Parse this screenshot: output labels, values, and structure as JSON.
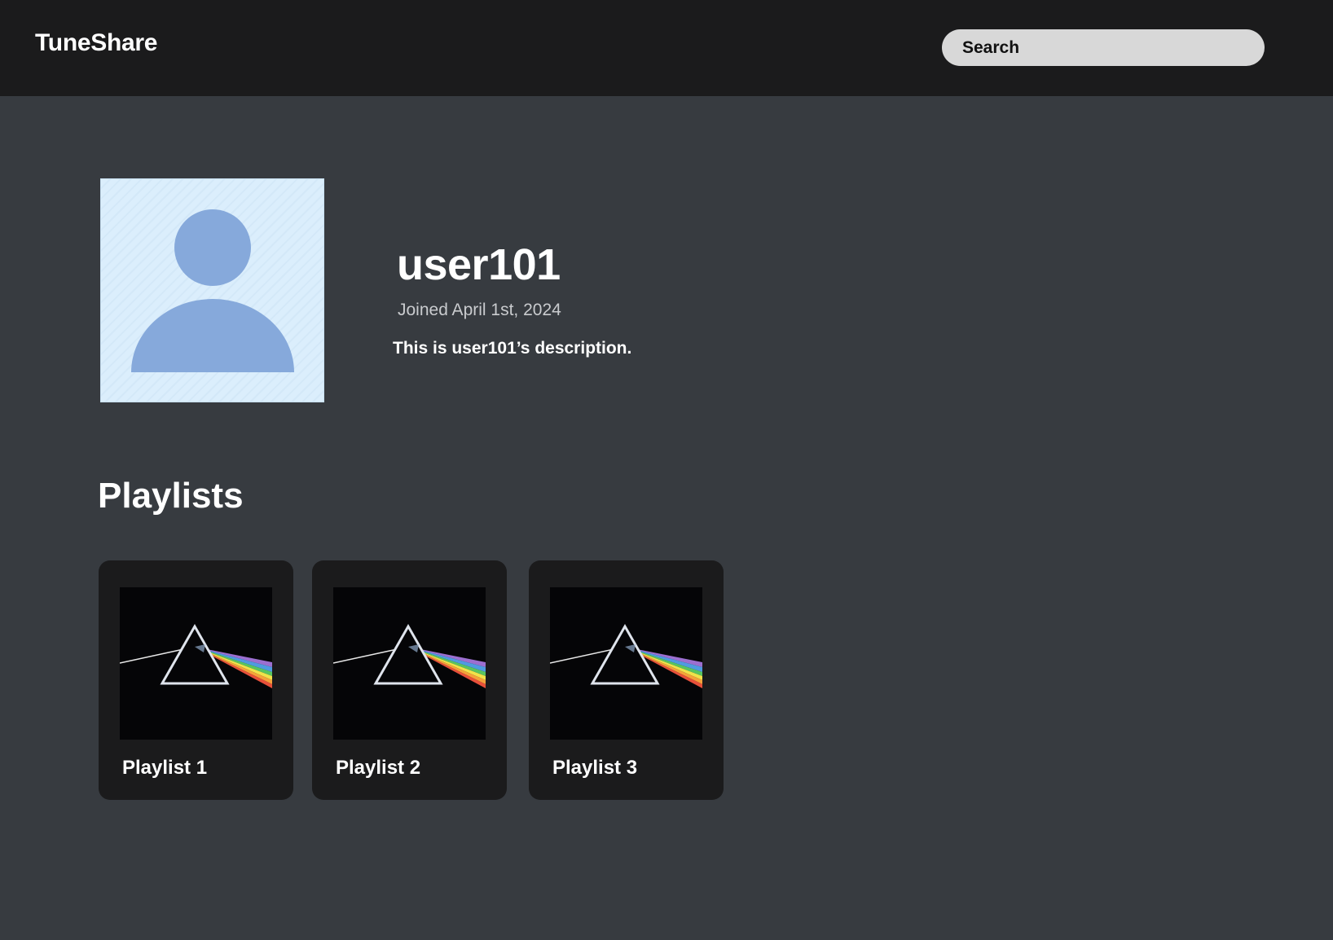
{
  "app": {
    "name": "TuneShare"
  },
  "header": {
    "search_placeholder": "Search"
  },
  "profile": {
    "username": "user101",
    "joined": "Joined April 1st, 2024",
    "description": "This is user101’s description.",
    "avatar_icon": "user-silhouette-icon"
  },
  "playlists": {
    "title": "Playlists",
    "items": [
      {
        "label": "Playlist 1",
        "cover_icon": "prism-album-cover"
      },
      {
        "label": "Playlist 2",
        "cover_icon": "prism-album-cover"
      },
      {
        "label": "Playlist 3",
        "cover_icon": "prism-album-cover"
      }
    ]
  },
  "colors": {
    "topbar_bg": "#1b1b1c",
    "page_bg": "#373b40",
    "card_bg": "#1b1b1c",
    "search_bg": "#d8d8d8",
    "avatar_bg": "#dbeefc",
    "avatar_figure": "#86a9db"
  }
}
